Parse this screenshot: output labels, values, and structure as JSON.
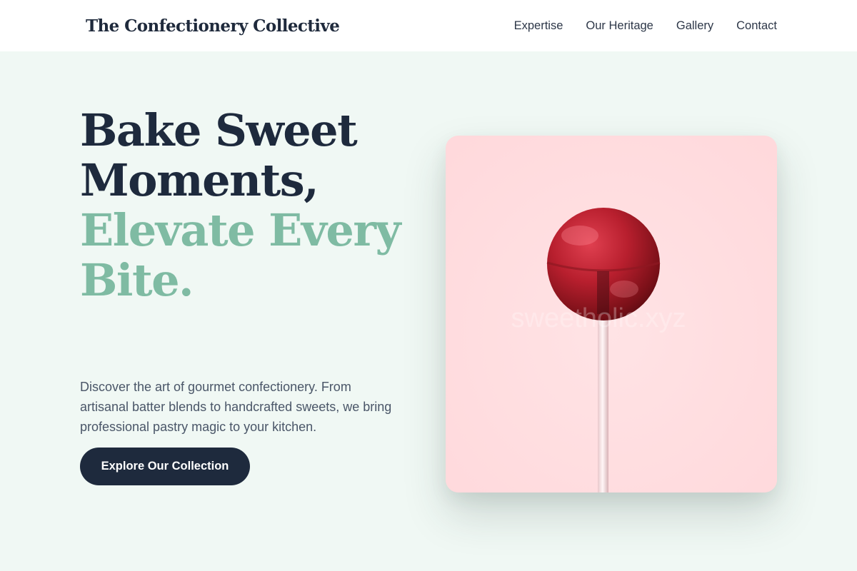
{
  "header": {
    "brand": "The Confectionery Collective",
    "nav": [
      {
        "label": "Expertise"
      },
      {
        "label": "Our Heritage"
      },
      {
        "label": "Gallery"
      },
      {
        "label": "Contact"
      }
    ]
  },
  "hero": {
    "headline_dark_line1": "Bake Sweet",
    "headline_dark_line2": "Moments,",
    "headline_accent_line1": "Elevate Every",
    "headline_accent_line2": "Bite.",
    "description": "Discover the art of gourmet confectionery. From artisanal batter blends to handcrafted sweets, we bring professional pastry magic to your kitchen.",
    "cta_label": "Explore Our Collection",
    "image": {
      "subject": "red-lollipop-photo",
      "watermark": "sweetholic.xyz"
    }
  },
  "colors": {
    "page_background": "#f0f8f4",
    "header_background": "#ffffff",
    "dark_text": "#1e2a3d",
    "accent_green": "#7fbba3",
    "card_pink": "#ffdde0",
    "lollipop_red": "#b81f2e"
  }
}
